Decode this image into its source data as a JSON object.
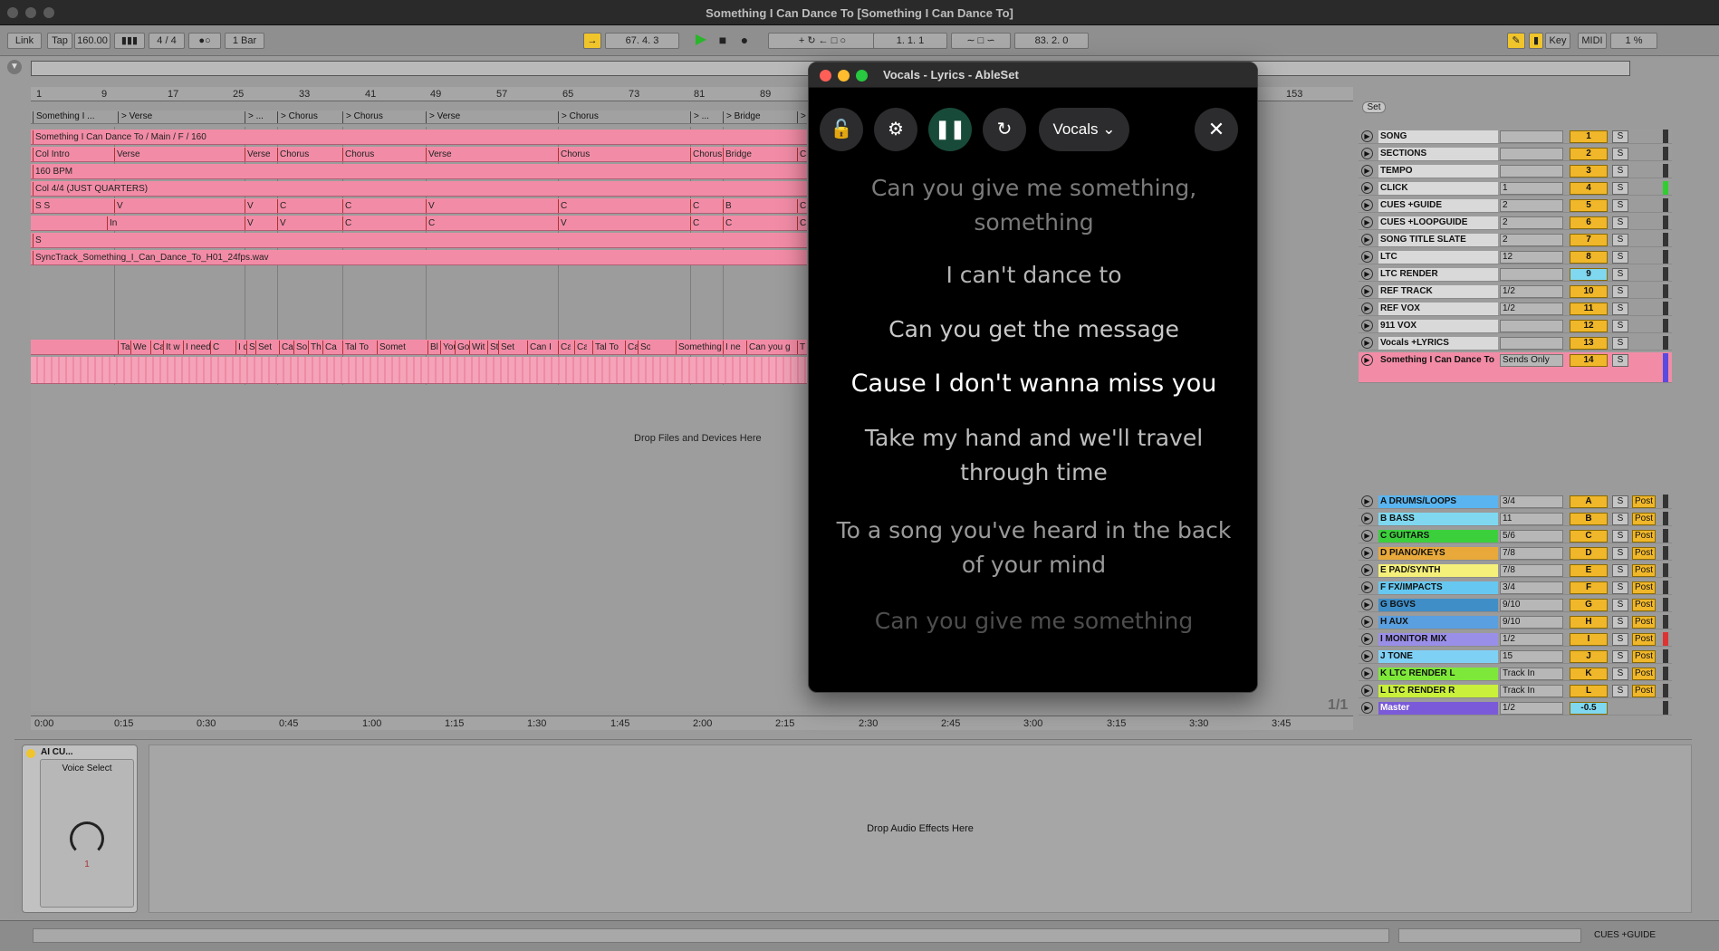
{
  "window": {
    "title": "Something I Can Dance To  [Something I Can Dance To]"
  },
  "transport": {
    "link": "Link",
    "tap": "Tap",
    "tempo": "160.00",
    "time_sig": "4 / 4",
    "quantize": "1 Bar",
    "position": "67.  4.  3",
    "loop_start": "1.   1.   1",
    "loop_len": "83.   2.   0",
    "key": "Key",
    "midi": "MIDI",
    "cpu": "1 %"
  },
  "ruler": {
    "bars": [
      "1",
      "9",
      "17",
      "25",
      "33",
      "41",
      "49",
      "57",
      "65",
      "73",
      "81",
      "89",
      "153"
    ]
  },
  "locators": [
    "Something I ...",
    "> Verse",
    "> ...",
    "> Chorus",
    "> Chorus",
    "> Verse",
    "> Chorus",
    "> ...",
    "> Bridge",
    "> Chor"
  ],
  "lanes": [
    {
      "clips": [
        "Something I Can Dance To / Main / F / 160"
      ]
    },
    {
      "clips": [
        "Col Intro",
        "Verse",
        "Verse",
        "Chorus",
        "Chorus",
        "Verse",
        "Chorus",
        "Chorus",
        "Bridge",
        "Chorus"
      ]
    },
    {
      "clips": [
        "160 BPM"
      ]
    },
    {
      "clips": [
        "Col 4/4 (JUST QUARTERS)"
      ]
    },
    {
      "clips": [
        "S S",
        "V",
        "V",
        "C",
        "C",
        "V",
        "C",
        "C",
        "B",
        "C"
      ]
    },
    {
      "clips": [
        "In",
        "V",
        "V",
        "C",
        "C",
        "V",
        "C",
        "C",
        "C"
      ]
    },
    {
      "clips": [
        "S"
      ]
    },
    {
      "clips": [
        "SyncTrack_Something_I_Can_Dance_To_H01_24fps.wav"
      ]
    }
  ],
  "lyric_clips": [
    "Ta",
    "We",
    "Ca",
    "It w",
    "I need",
    "C",
    "I d",
    "Sc",
    "Set",
    "Ca",
    "So",
    "Th",
    "Ca",
    "Tal To",
    "Somet",
    "Bl",
    "You",
    "Go",
    "Wit",
    "St",
    "Set",
    "Can I",
    "Ca",
    "Ca",
    "Tal To",
    "Ca",
    "So",
    "Something",
    "I ne",
    "Can you g",
    "T"
  ],
  "drop_files": "Drop Files and Devices Here",
  "time_axis": [
    "0:00",
    "0:15",
    "0:30",
    "0:45",
    "1:00",
    "1:15",
    "1:30",
    "1:45",
    "2:00",
    "2:15",
    "2:30",
    "2:45",
    "3:00",
    "3:15",
    "3:30",
    "3:45"
  ],
  "page_indicator": "1/1",
  "set_label": "Set",
  "tracks": [
    {
      "name": "SONG",
      "io": "",
      "num": "1",
      "color": "#d9d9d9"
    },
    {
      "name": "SECTIONS",
      "io": "",
      "num": "2",
      "color": "#d9d9d9"
    },
    {
      "name": "TEMPO",
      "io": "",
      "num": "3",
      "color": "#d9d9d9"
    },
    {
      "name": "CLICK",
      "io": "1",
      "num": "4",
      "color": "#d9d9d9"
    },
    {
      "name": "CUES +GUIDE",
      "io": "2",
      "num": "5",
      "color": "#d9d9d9"
    },
    {
      "name": "CUES +LOOPGUIDE",
      "io": "2",
      "num": "6",
      "color": "#d9d9d9"
    },
    {
      "name": "SONG TITLE SLATE",
      "io": "2",
      "num": "7",
      "color": "#d9d9d9"
    },
    {
      "name": "LTC",
      "io": "12",
      "num": "8",
      "color": "#d9d9d9"
    },
    {
      "name": "LTC RENDER",
      "io": "",
      "num": "9",
      "color": "#d9d9d9"
    },
    {
      "name": "REF TRACK",
      "io": "1/2",
      "num": "10",
      "color": "#d9d9d9"
    },
    {
      "name": "REF VOX",
      "io": "1/2",
      "num": "11",
      "color": "#d9d9d9"
    },
    {
      "name": "911 VOX",
      "io": "",
      "num": "12",
      "color": "#d9d9d9"
    },
    {
      "name": "Vocals +LYRICS",
      "io": "",
      "num": "13",
      "color": "#d9d9d9"
    },
    {
      "name": "Something I Can Dance To",
      "io": "Sends Only",
      "num": "14",
      "color": "#f28ca6"
    }
  ],
  "return_tracks": [
    {
      "name": "A DRUMS/LOOPS",
      "io": "3/4",
      "num": "A",
      "color": "#5ab4f0"
    },
    {
      "name": "B BASS",
      "io": "11",
      "num": "B",
      "color": "#7fd8f0"
    },
    {
      "name": "C GUITARS",
      "io": "5/6",
      "num": "C",
      "color": "#3ccf3c"
    },
    {
      "name": "D PIANO/KEYS",
      "io": "7/8",
      "num": "D",
      "color": "#e8a93a"
    },
    {
      "name": "E PAD/SYNTH",
      "io": "7/8",
      "num": "E",
      "color": "#f5f07a"
    },
    {
      "name": "F FX/IMPACTS",
      "io": "3/4",
      "num": "F",
      "color": "#66c8f0"
    },
    {
      "name": "G BGVS",
      "io": "9/10",
      "num": "G",
      "color": "#3f8ec8"
    },
    {
      "name": "H AUX",
      "io": "9/10",
      "num": "H",
      "color": "#5a9fe0"
    },
    {
      "name": "I MONITOR MIX",
      "io": "1/2",
      "num": "I",
      "color": "#9a8fe8"
    },
    {
      "name": "J TONE",
      "io": "15",
      "num": "J",
      "color": "#7fd0f5"
    },
    {
      "name": "K LTC RENDER L",
      "io": "Track In",
      "num": "K",
      "color": "#7ee83a"
    },
    {
      "name": "L LTC RENDER R",
      "io": "Track In",
      "num": "L",
      "color": "#c9f03a"
    },
    {
      "name": "Master",
      "io": "1/2",
      "num": "-0.5",
      "color": "#7a5ad8"
    }
  ],
  "solo": "S",
  "post": "Post",
  "device": {
    "name": "AI CU...",
    "voice_select": "Voice Select",
    "knob_value": "1"
  },
  "drop_audio": "Drop Audio Effects Here",
  "status": {
    "track": "CUES +GUIDE"
  },
  "ableset": {
    "title": "Vocals - Lyrics - AbleSet",
    "selector": "Vocals",
    "lyrics": [
      "Can you give me something, something",
      "I can't dance to",
      "Can you get the message",
      "Cause I don't wanna miss you",
      "Take my hand and we'll travel through time",
      "To a song you've heard in the back of your mind",
      "Can you give me something"
    ]
  }
}
